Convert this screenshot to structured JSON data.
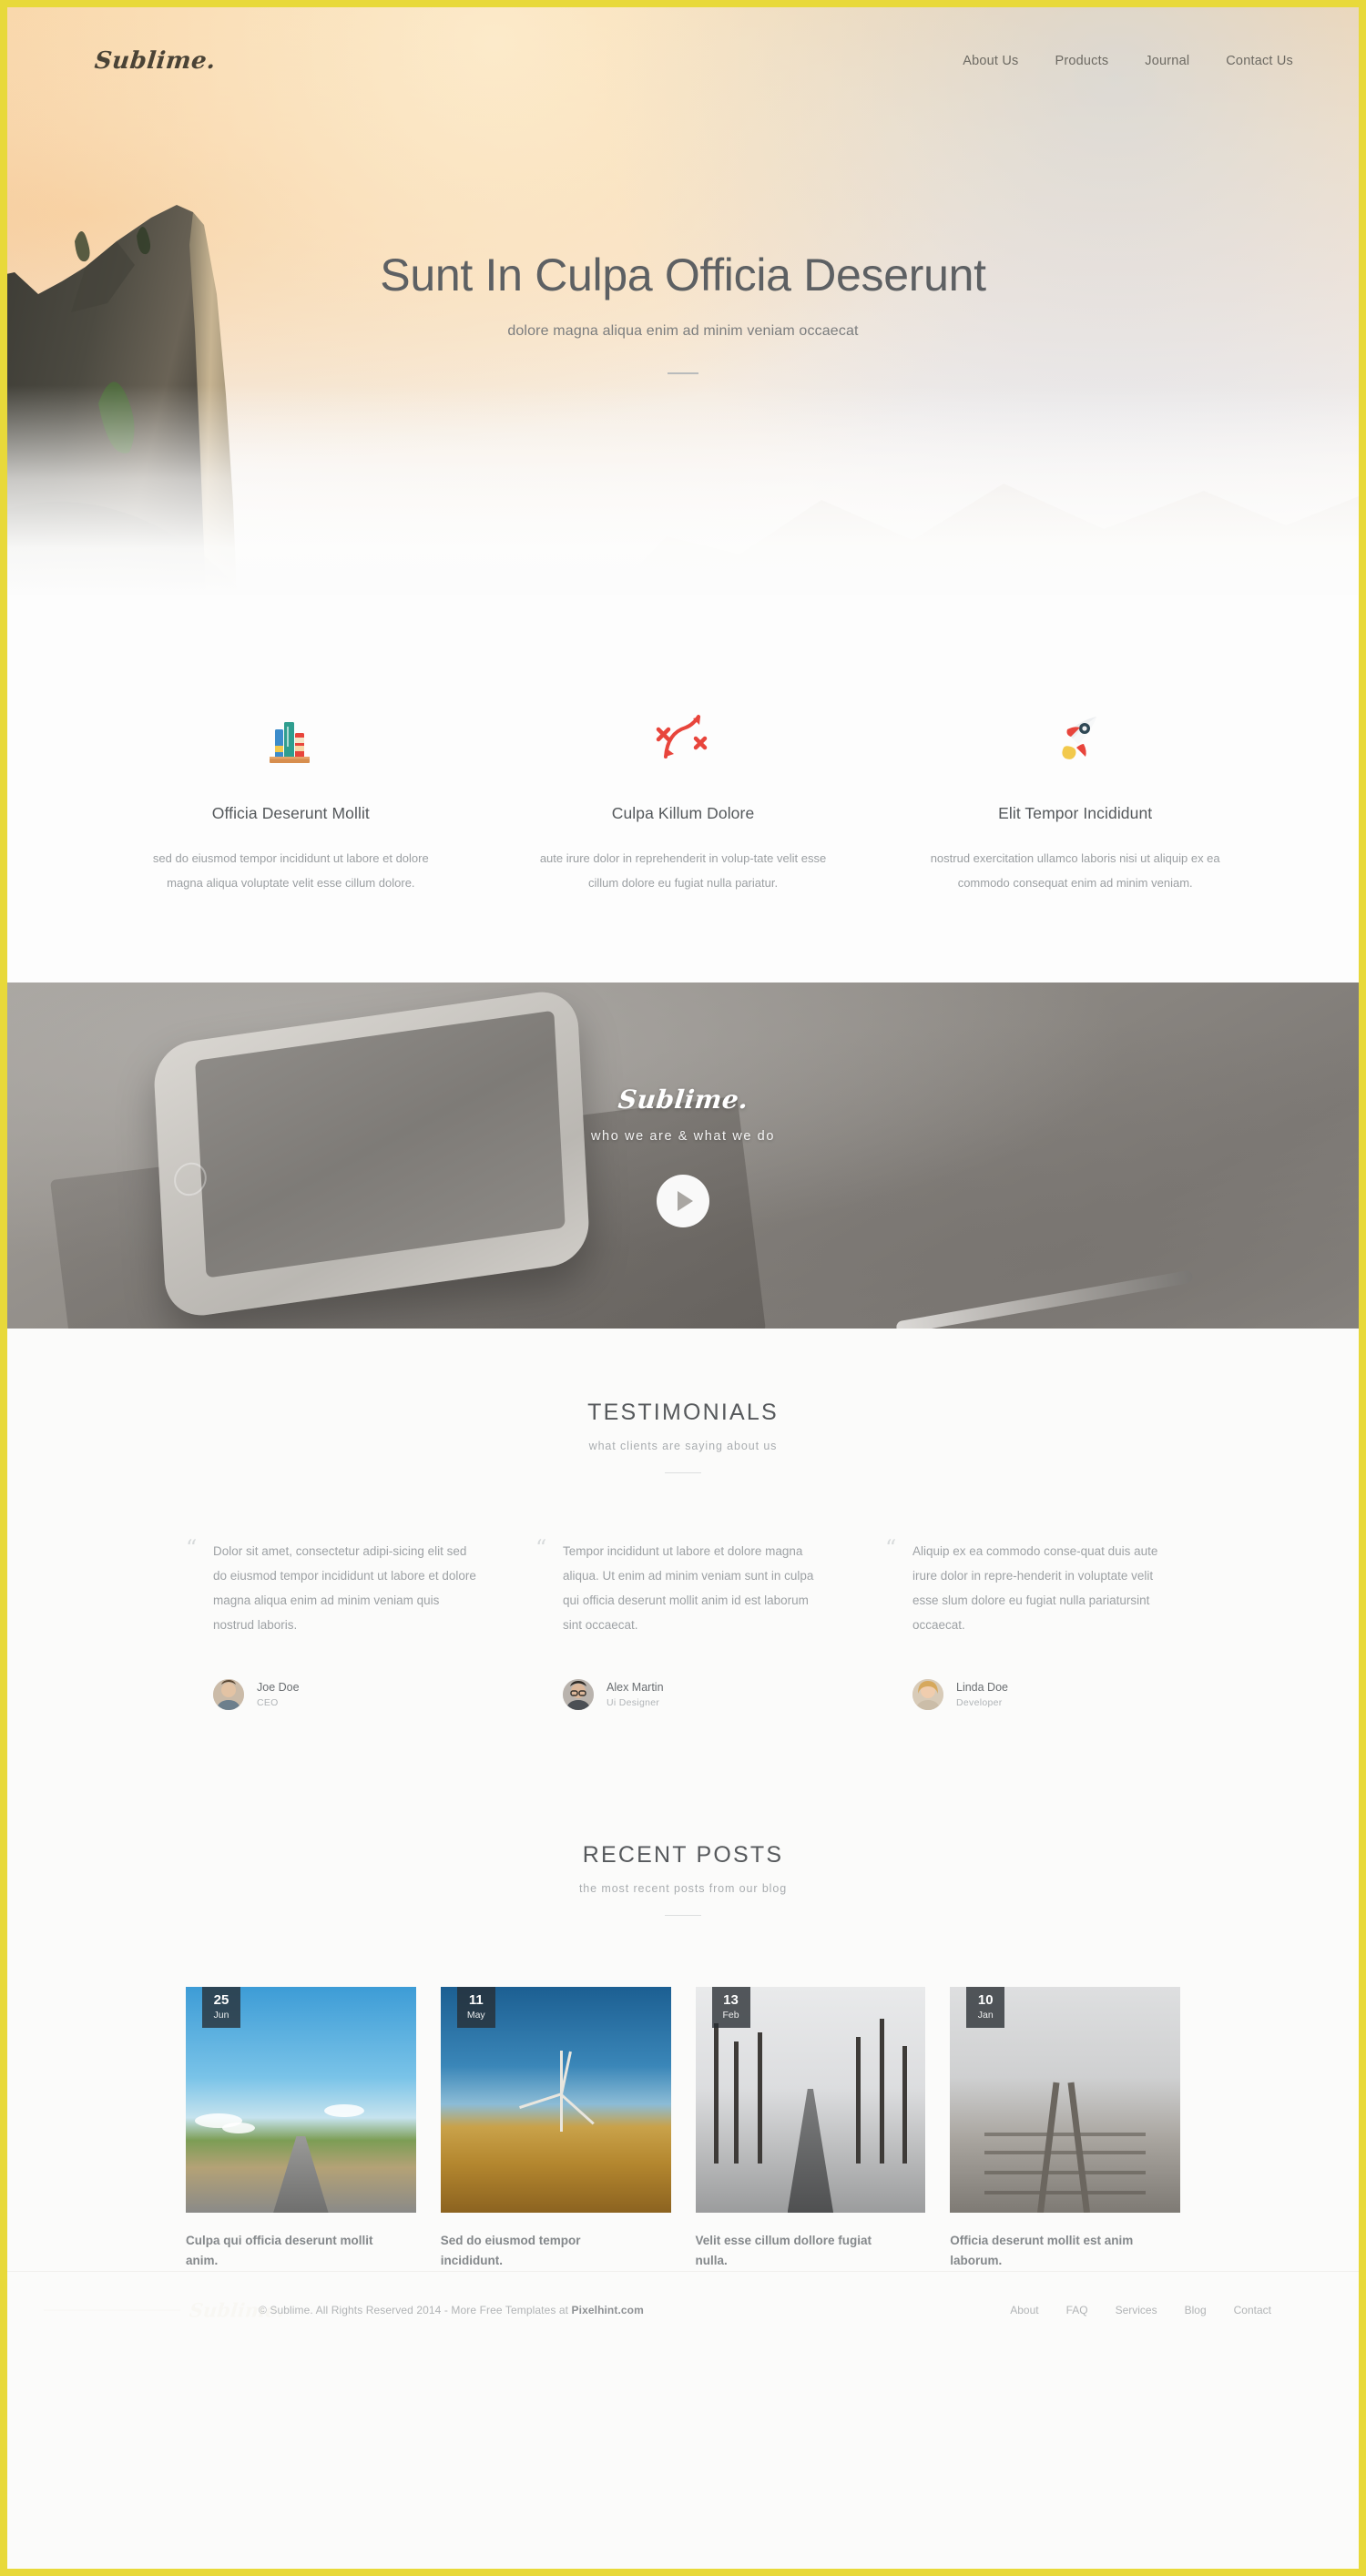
{
  "brand": {
    "name": "Sublime."
  },
  "nav": {
    "items": [
      {
        "label": "About Us"
      },
      {
        "label": "Products"
      },
      {
        "label": "Journal"
      },
      {
        "label": "Contact Us"
      }
    ]
  },
  "hero": {
    "title": "Sunt In Culpa Officia Deserunt",
    "subtitle": "dolore magna aliqua enim ad minim veniam occaecat"
  },
  "features": [
    {
      "icon": "books-icon",
      "title": "Officia Deserunt Mollit",
      "text": "sed do eiusmod tempor incididunt ut labore et dolore magna aliqua voluptate velit esse cillum dolore."
    },
    {
      "icon": "arrows-target-icon",
      "title": "Culpa Killum Dolore",
      "text": "aute irure dolor in reprehenderit in volup-tate velit esse cillum dolore eu fugiat nulla pariatur."
    },
    {
      "icon": "rocket-icon",
      "title": "Elit Tempor Incididunt",
      "text": "nostrud exercitation ullamco laboris nisi ut aliquip ex ea commodo consequat enim ad minim veniam."
    }
  ],
  "video": {
    "logo": "Sublime.",
    "tagline": "who we are & what we do",
    "play_label": "play-button"
  },
  "testimonials": {
    "title": "TESTIMONIALS",
    "subtitle": "what clients are saying about us",
    "items": [
      {
        "quote": "Dolor sit amet, consectetur adipi-sicing elit sed do eiusmod tempor incididunt ut labore et dolore magna aliqua enim ad minim veniam quis nostrud laboris.",
        "name": "Joe Doe",
        "role": "CEO"
      },
      {
        "quote": "Tempor incididunt ut labore et dolore magna aliqua. Ut enim ad minim veniam sunt in culpa qui officia deserunt mollit anim id est laborum sint occaecat.",
        "name": "Alex Martin",
        "role": "Ui Designer"
      },
      {
        "quote": "Aliquip ex ea commodo conse-quat duis aute irure dolor in repre-henderit in voluptate velit esse slum dolore eu fugiat nulla pariatursint occaecat.",
        "name": "Linda Doe",
        "role": "Developer"
      }
    ]
  },
  "posts": {
    "title": "RECENT POSTS",
    "subtitle": "the most recent posts from our blog",
    "items": [
      {
        "day": "25",
        "month": "Jun",
        "title": "Culpa qui officia deserunt mollit anim."
      },
      {
        "day": "11",
        "month": "May",
        "title": "Sed do eiusmod tempor incididunt."
      },
      {
        "day": "13",
        "month": "Feb",
        "title": "Velit esse cillum dollore fugiat nulla."
      },
      {
        "day": "10",
        "month": "Jan",
        "title": "Officia deserunt mollit est anim laborum."
      }
    ]
  },
  "footer": {
    "watermark": "Sublime.",
    "copyright_prefix": "© Sublime. All Rights Reserved 2014 - More Free Templates at ",
    "copyright_link": "Pixelhint.com",
    "links": [
      {
        "label": "About"
      },
      {
        "label": "FAQ"
      },
      {
        "label": "Services"
      },
      {
        "label": "Blog"
      },
      {
        "label": "Contact"
      }
    ]
  },
  "colors": {
    "frame": "#e8d93a",
    "heading": "#56595c",
    "body": "#9ea2a5",
    "accent_red": "#e8453c",
    "accent_yellow": "#f2c94c"
  }
}
